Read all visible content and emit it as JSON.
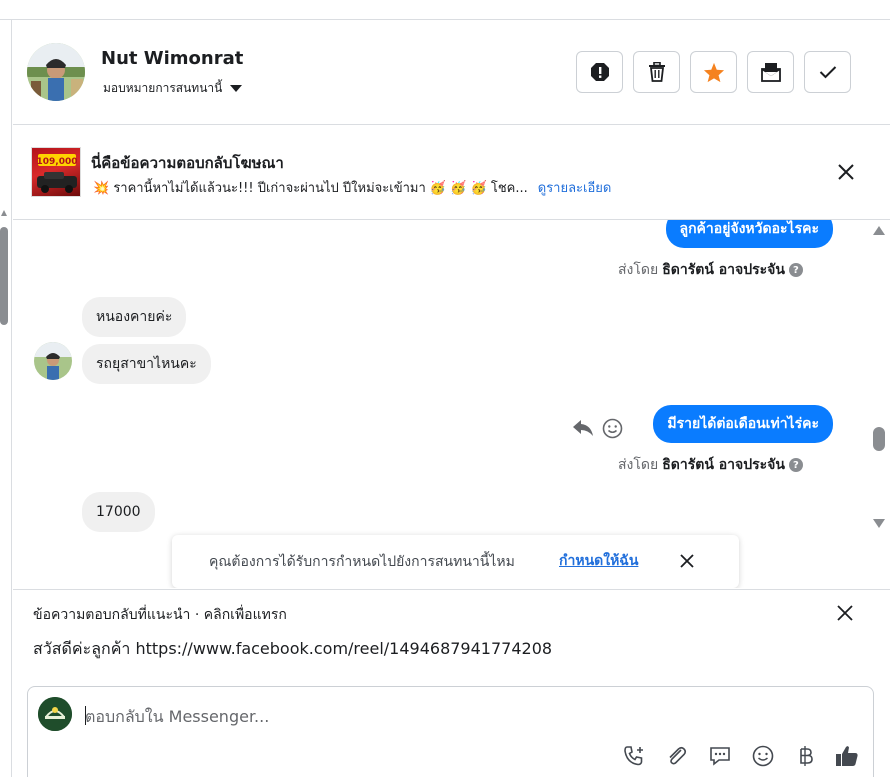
{
  "header": {
    "name": "Nut Wimonrat",
    "assign_label": "มอบหมายการสนทนานี้",
    "actions": [
      {
        "id": "spam",
        "icon": "alert-octagon-icon"
      },
      {
        "id": "delete",
        "icon": "trash-icon"
      },
      {
        "id": "star",
        "icon": "star-icon",
        "color": "#f5821f"
      },
      {
        "id": "mark-unread",
        "icon": "open-envelope-icon"
      },
      {
        "id": "done",
        "icon": "checkmark-icon"
      }
    ]
  },
  "ad_banner": {
    "title": "นี่คือข้อความตอบกลับโฆษณา",
    "snippet": "💥 ราคานี้หาไม่ได้แล้วนะ!!! ปีเก่าจะผ่านไป ปีใหม่จะเข้ามา 🥳 🥳 🥳 โชค...",
    "link": "ดูรายละเอียด",
    "thumb_text": "109,000"
  },
  "messages": {
    "out_1": "ลูกค้าอยู่จังหวัดอะไรคะ",
    "sent_by_prefix_1": "ส่งโดย",
    "sent_by_name_1": "ธิดารัตน์ อาจประจัน",
    "in_1": "หนองคายค่ะ",
    "in_2": "รถยุสาขาไหนคะ",
    "out_2": "มีรายได้ต่อเดือนเท่าไร่คะ",
    "sent_by_prefix_2": "ส่งโดย",
    "sent_by_name_2": "ธิดารัตน์ อาจประจัน",
    "in_3": "17000"
  },
  "assign_prompt": {
    "text": "คุณต้องการได้รับการกำหนดไปยังการสนทนานี้ไหม",
    "link": "กำหนดให้ฉัน"
  },
  "suggested_reply": {
    "title": "ข้อความตอบกลับที่แนะนำ · คลิกเพื่อแทรก",
    "text": "สวัสดีค่ะลูกค้า https://www.facebook.com/reel/1494687941774208"
  },
  "composer": {
    "placeholder": "ตอบกลับใน Messenger...",
    "tools": [
      "phone-plus-icon",
      "paperclip-icon",
      "chat-bubble-icon",
      "emoji-icon",
      "baht-icon",
      "thumbs-up-icon"
    ]
  },
  "colors": {
    "accent": "#0a7cff",
    "link": "#216fdb",
    "star": "#f5821f"
  }
}
